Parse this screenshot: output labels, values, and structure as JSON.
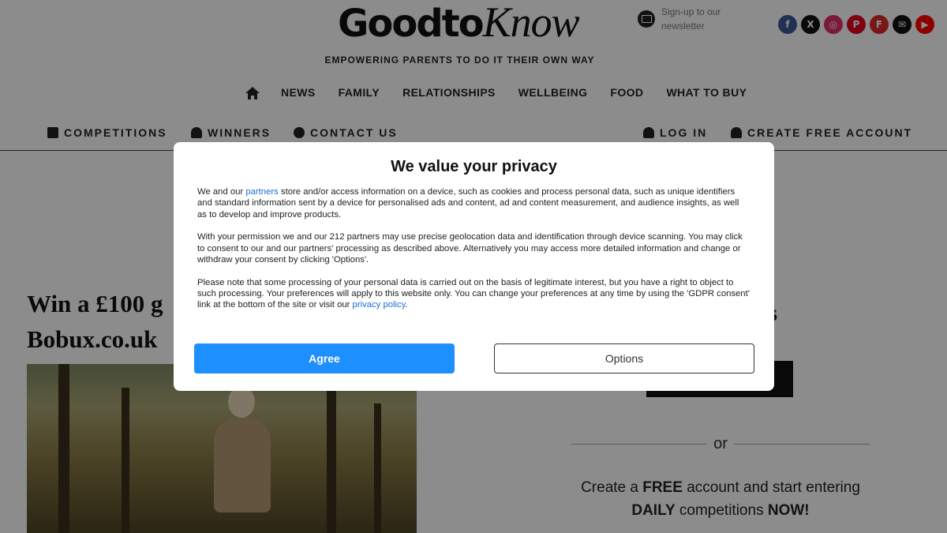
{
  "header": {
    "logo_part1": "Goodto",
    "logo_part2": "Know",
    "newsletter_text": "Sign-up to our newsletter",
    "tagline": "EMPOWERING PARENTS TO DO IT THEIR OWN WAY",
    "socials": [
      {
        "icon": "facebook-icon",
        "glyph": "f",
        "color": "#3b5998"
      },
      {
        "icon": "x-icon",
        "glyph": "X",
        "color": "#111111"
      },
      {
        "icon": "instagram-icon",
        "glyph": "◎",
        "color": "#e1306c"
      },
      {
        "icon": "pinterest-icon",
        "glyph": "P",
        "color": "#e60023"
      },
      {
        "icon": "flipboard-icon",
        "glyph": "F",
        "color": "#e12828"
      },
      {
        "icon": "email-icon",
        "glyph": "✉",
        "color": "#111111"
      },
      {
        "icon": "youtube-icon",
        "glyph": "▶",
        "color": "#ff0000"
      }
    ]
  },
  "main_nav": [
    "NEWS",
    "FAMILY",
    "RELATIONSHIPS",
    "WELLBEING",
    "FOOD",
    "WHAT TO BUY"
  ],
  "sub_nav": {
    "competitions": "COMPETITIONS",
    "winners": "WINNERS",
    "contact": "CONTACT US",
    "login": "LOG IN",
    "create_account": "CREATE FREE ACCOUNT"
  },
  "article": {
    "title": "Win a £100 g Bobux.co.uk"
  },
  "sidebar": {
    "title_fragment": "bers",
    "or": "or",
    "cta_pre": "Create a ",
    "cta_free": "FREE",
    "cta_mid": " account and start entering ",
    "cta_daily": "DAILY",
    "cta_mid2": " competitions ",
    "cta_now": "NOW!"
  },
  "consent": {
    "title": "We value your privacy",
    "p1_pre": "We and our ",
    "p1_link": "partners",
    "p1_post": " store and/or access information on a device, such as cookies and process personal data, such as unique identifiers and standard information sent by a device for personalised ads and content, ad and content measurement, and audience insights, as well as to develop and improve products.",
    "p2": "With your permission we and our 212 partners may use precise geolocation data and identification through device scanning. You may click to consent to our and our partners' processing as described above. Alternatively you may access more detailed information and change or withdraw your consent by clicking 'Options'.",
    "p3_pre": "Please note that some processing of your personal data is carried out on the basis of legitimate interest, but you have a right to object to such processing. Your preferences will apply to this website only. You can change your preferences at any time by using the 'GDPR consent' link at the bottom of the site or visit our ",
    "p3_link": "privacy policy",
    "p3_post": ".",
    "agree_label": "Agree",
    "options_label": "Options",
    "agree_color": "#1e8fff"
  }
}
